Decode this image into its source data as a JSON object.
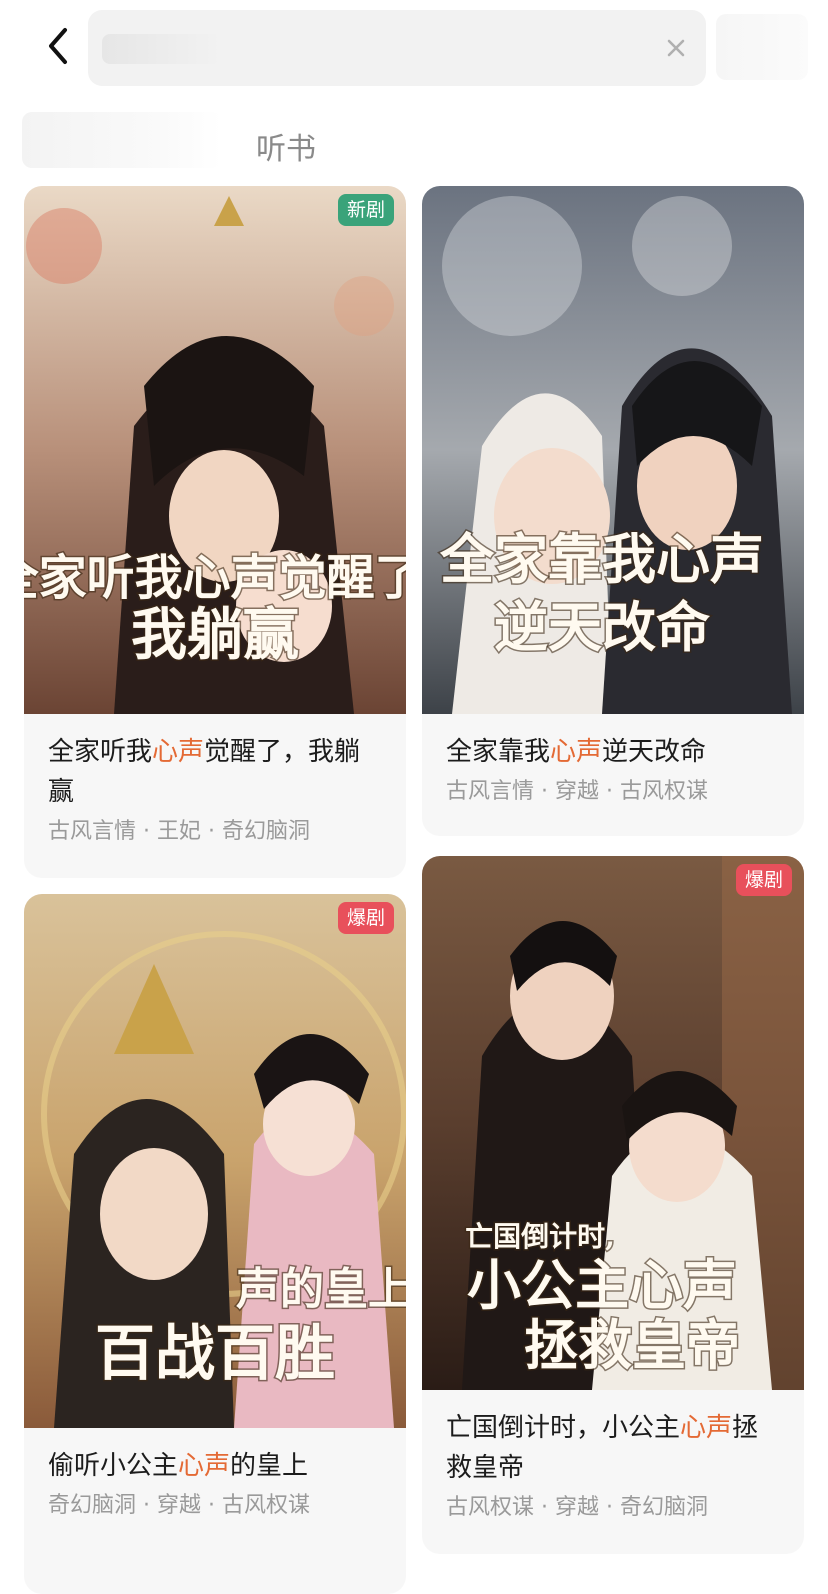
{
  "header": {
    "back_icon": "chevron-left-icon",
    "clear_icon": "close-icon"
  },
  "tabs": {
    "audiobook": "听书"
  },
  "colors": {
    "highlight": "#e46a35",
    "badge_new": "#3aa37a",
    "badge_hot": "#e8505b",
    "tag_text": "#9a9a9a"
  },
  "cards": [
    {
      "badge": "新剧",
      "title_before": "全家听我",
      "title_highlight": "心声",
      "title_after": "觉醒了，我躺赢",
      "tags": "古风言情 · 王妃 · 奇幻脑洞",
      "cover_text_line1": "全家听我心声觉醒了,",
      "cover_text_line2": "我躺赢"
    },
    {
      "badge": "",
      "title_before": "全家靠我",
      "title_highlight": "心声",
      "title_after": "逆天改命",
      "tags": "古风言情 · 穿越 · 古风权谋",
      "cover_text_line1": "全家靠我心声",
      "cover_text_line2": "逆天改命"
    },
    {
      "badge": "爆剧",
      "title_before": "偷听小公主",
      "title_highlight": "心声",
      "title_after": "的皇上",
      "tags": "奇幻脑洞 · 穿越 · 古风权谋",
      "cover_text_line1": "声的皇上",
      "cover_text_line2": "百战百胜"
    },
    {
      "badge": "爆剧",
      "title_before": "亡国倒计时，小公主",
      "title_highlight": "心声",
      "title_after": "拯救皇帝",
      "tags": "古风权谋 · 穿越 · 奇幻脑洞",
      "cover_text_line0": "亡国倒计时,",
      "cover_text_line1": "小公主心声",
      "cover_text_line2": "拯救皇帝"
    }
  ]
}
